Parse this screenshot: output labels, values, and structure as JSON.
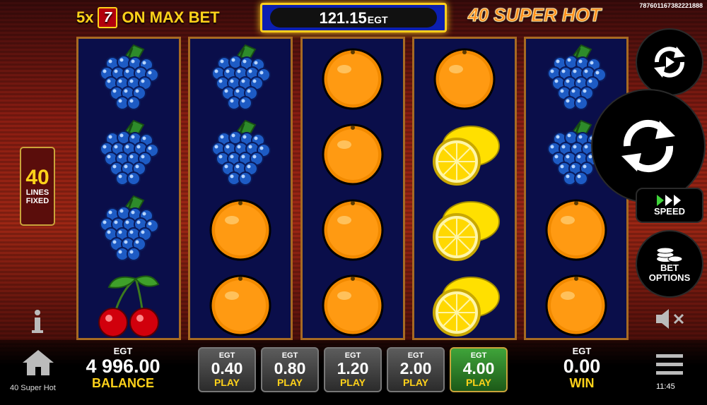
{
  "promo": {
    "multiplier": "5x",
    "seven": "7",
    "text": "ON MAX BET"
  },
  "jackpot": {
    "amount": "121.15",
    "currency": "EGT"
  },
  "game_title": "40 SUPER HOT",
  "game_id": "7876011673822218​88",
  "lines": {
    "count": "40",
    "line1": "LINES",
    "line2": "FIXED"
  },
  "reels": [
    [
      "grapes",
      "grapes",
      "grapes",
      "cherries"
    ],
    [
      "grapes",
      "grapes",
      "orange",
      "orange"
    ],
    [
      "orange",
      "orange",
      "orange",
      "orange"
    ],
    [
      "orange",
      "lemon",
      "lemon",
      "lemon"
    ],
    [
      "grapes",
      "grapes",
      "orange",
      "orange"
    ]
  ],
  "balance": {
    "currency": "EGT",
    "value": "4 996.00",
    "label": "BALANCE"
  },
  "bets": [
    {
      "currency": "EGT",
      "value": "0.40",
      "label": "PLAY",
      "selected": false
    },
    {
      "currency": "EGT",
      "value": "0.80",
      "label": "PLAY",
      "selected": false
    },
    {
      "currency": "EGT",
      "value": "1.20",
      "label": "PLAY",
      "selected": false
    },
    {
      "currency": "EGT",
      "value": "2.00",
      "label": "PLAY",
      "selected": false
    },
    {
      "currency": "EGT",
      "value": "4.00",
      "label": "PLAY",
      "selected": true
    }
  ],
  "win": {
    "currency": "EGT",
    "value": "0.00",
    "label": "WIN"
  },
  "controls": {
    "autoplay_icon": "autoplay-icon",
    "spin_icon": "spin-icon",
    "speed_label": "SPEED",
    "bet_options_line1": "BET",
    "bet_options_line2": "OPTIONS",
    "mute_icon": "speaker-muted-icon",
    "menu_icon": "hamburger-icon",
    "info_icon": "info-icon",
    "home_icon": "home-icon"
  },
  "footer": {
    "game_name": "40 Super Hot",
    "clock": "11:45"
  },
  "colors": {
    "accent_yellow": "#ffd21a",
    "reel_bg": "#0a0e4a",
    "selected_bet": "#3fa43a"
  }
}
